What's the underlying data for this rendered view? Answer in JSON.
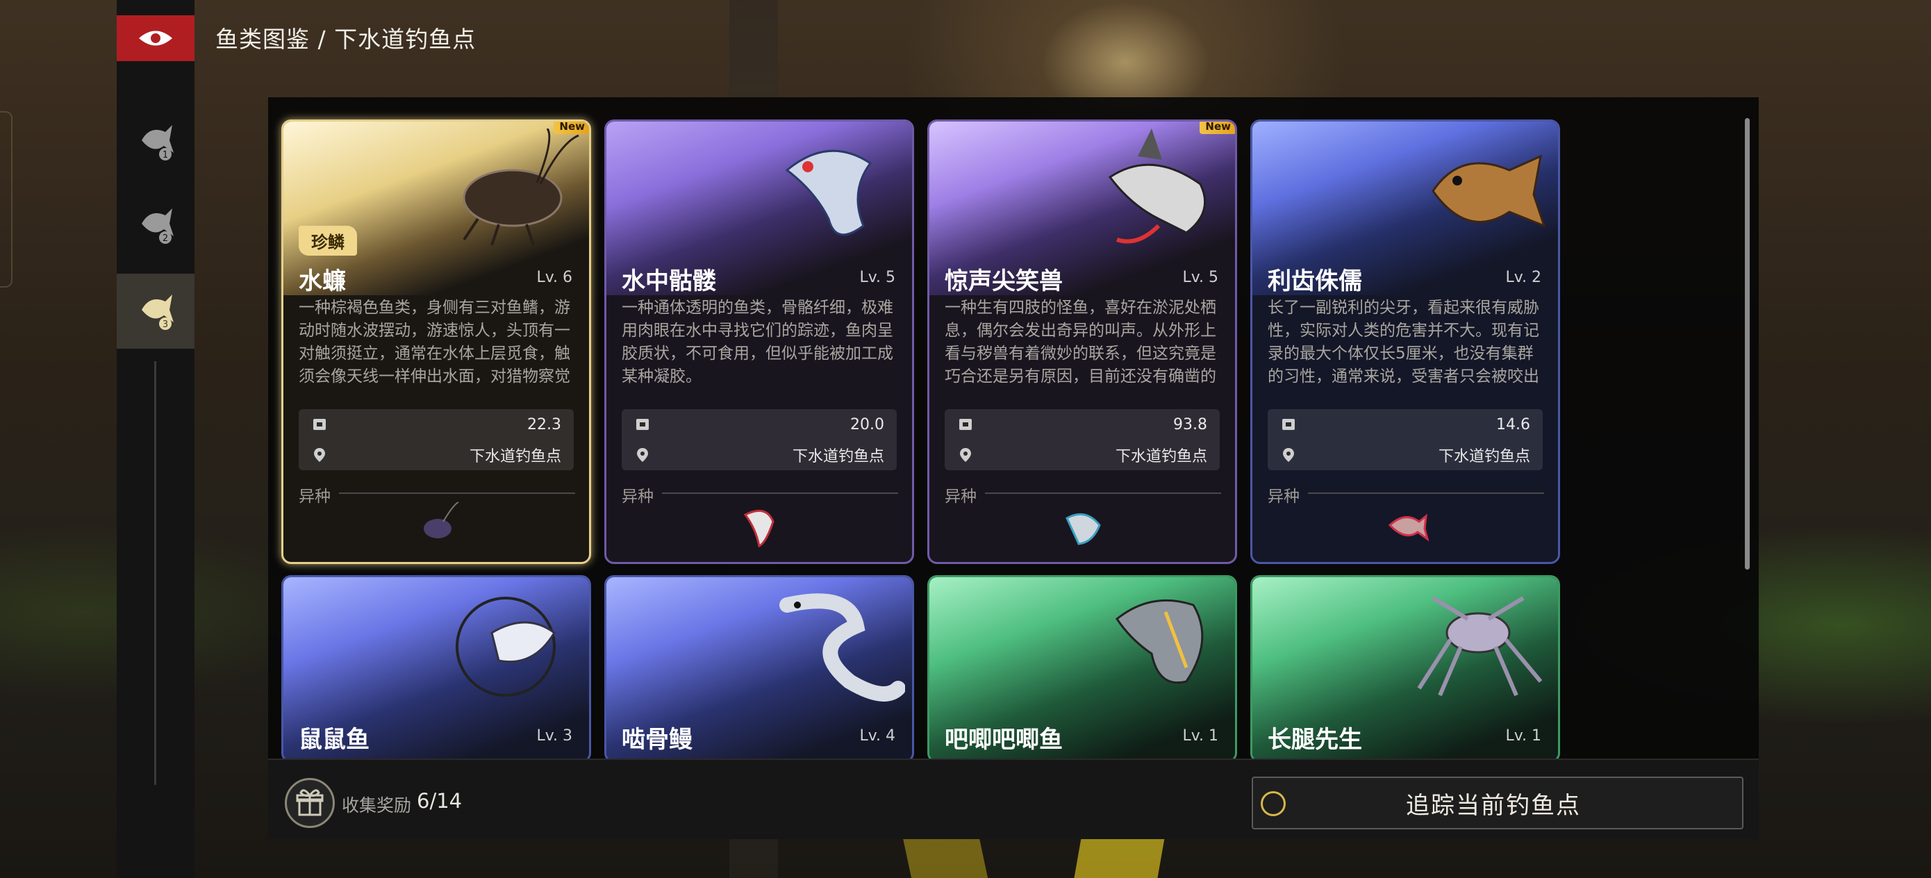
{
  "header": {
    "breadcrumb": "鱼类图鉴 / 下水道钓鱼点"
  },
  "sidebar": {
    "items": [
      {
        "badge": "1"
      },
      {
        "badge": "2"
      },
      {
        "badge": "3"
      }
    ]
  },
  "cards": [
    {
      "name": "水蠊",
      "lv": "Lv. 6",
      "new_badge": "New",
      "rarity": "珍鳞",
      "desc": "一种棕褐色鱼类，身侧有三对鱼鳍，游动时随水波摆动，游速惊人，头顶有一对触须挺立，通常在水体上层觅食，触须会像天线一样伸出水面，对猎物察觉不余，甚至",
      "weight": "22.3",
      "location": "下水道钓鱼点",
      "variant_label": "异种"
    },
    {
      "name": "水中骷髅",
      "lv": "Lv. 5",
      "desc": "一种通体透明的鱼类，骨骼纤细，极难用肉眼在水中寻找它们的踪迹，鱼肉呈胶质状，不可食用，但似乎能被加工成某种凝胶。",
      "weight": "20.0",
      "location": "下水道钓鱼点",
      "variant_label": "异种"
    },
    {
      "name": "惊声尖笑兽",
      "lv": "Lv. 5",
      "new_badge": "New",
      "desc": "一种生有四肢的怪鱼，喜好在淤泥处栖息，偶尔会发出奇异的叫声。从外形上看与秽兽有着微妙的联系，但这究竟是巧合还是另有原因，目前还没有确凿的研究",
      "weight": "93.8",
      "location": "下水道钓鱼点",
      "variant_label": "异种"
    },
    {
      "name": "利齿侏儒",
      "lv": "Lv. 2",
      "desc": "长了一副锐利的尖牙，看起来很有威胁性，实际对人类的危害并不大。现有记录的最大个体仅长5厘米，也没有集群的习性，通常来说，受害者只会被咬出一个豆径",
      "weight": "14.6",
      "location": "下水道钓鱼点",
      "variant_label": "异种"
    },
    {
      "name": "鼠鼠鱼",
      "lv": "Lv. 3"
    },
    {
      "name": "啮骨鳗",
      "lv": "Lv. 4"
    },
    {
      "name": "吧唧吧唧鱼",
      "lv": "Lv. 1"
    },
    {
      "name": "长腿先生",
      "lv": "Lv. 1"
    }
  ],
  "footer": {
    "reward_label": "收集奖励",
    "reward_count": "6/14",
    "track_label": "追踪当前钓鱼点"
  },
  "colors": {
    "accent_red": "#b01e22",
    "gold": "#f0d78c",
    "new_badge": "#f4c343"
  }
}
